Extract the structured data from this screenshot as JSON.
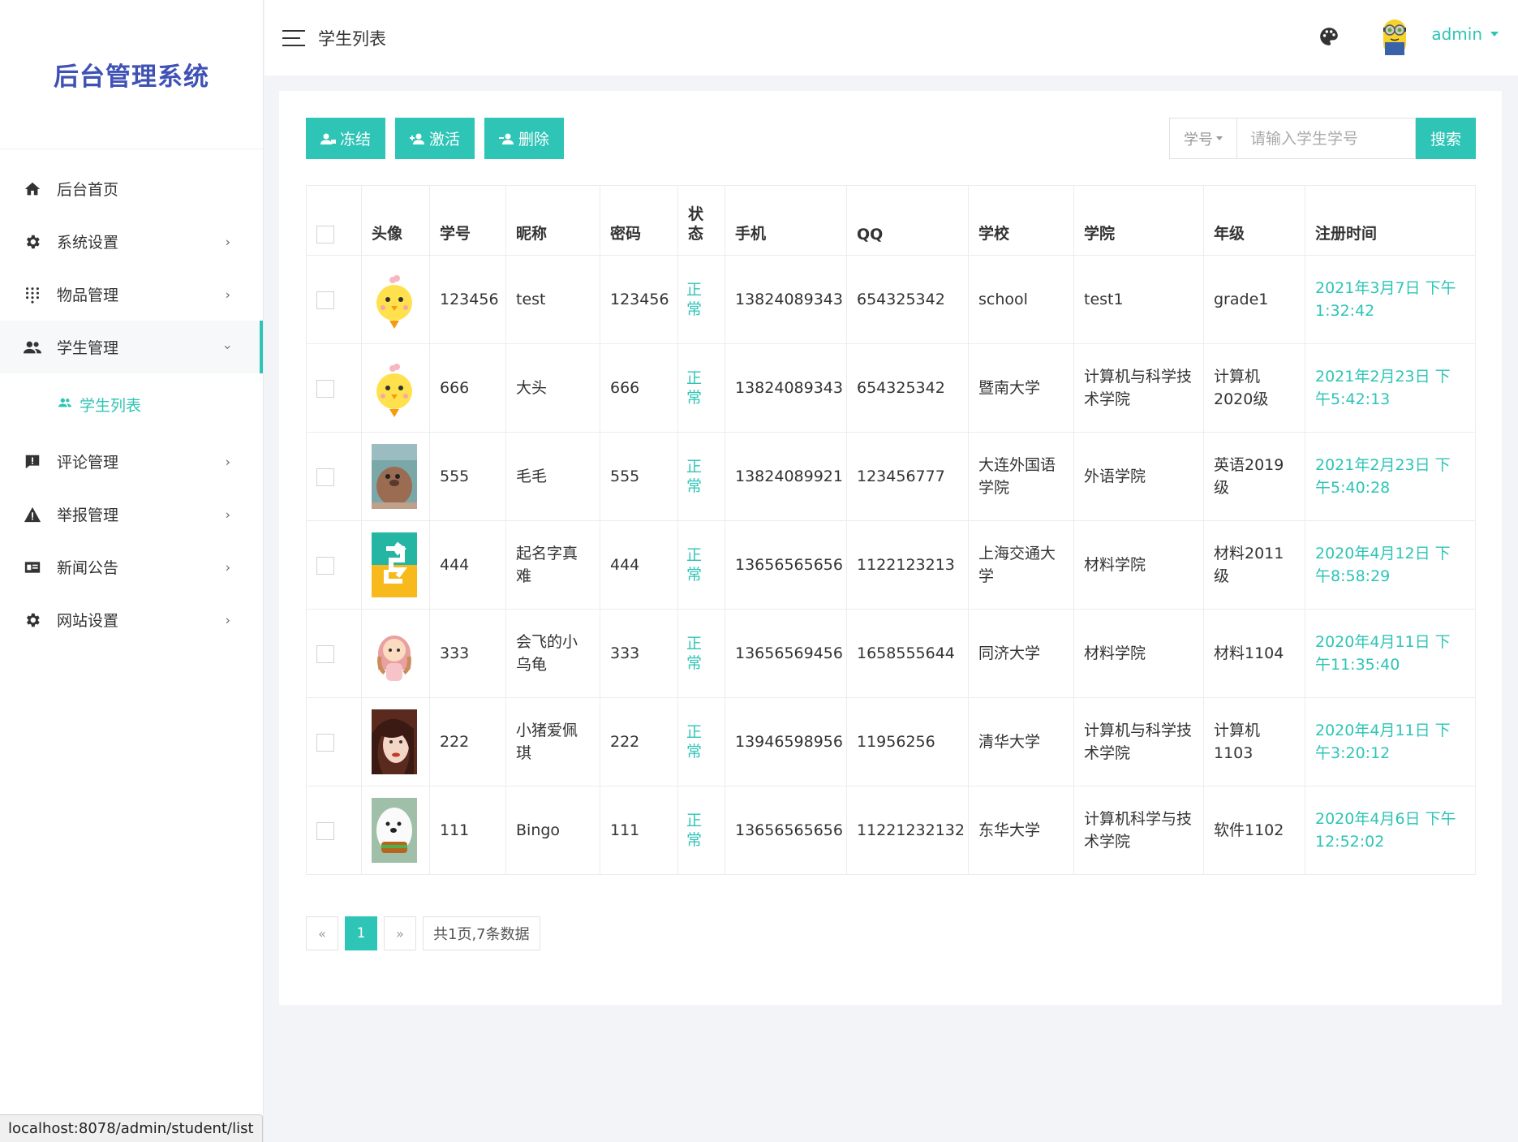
{
  "brand": "后台管理系统",
  "sidebar": {
    "items": [
      {
        "label": "后台首页",
        "icon": "home-icon"
      },
      {
        "label": "系统设置",
        "icon": "gear-icon"
      },
      {
        "label": "物品管理",
        "icon": "grid-dots-icon"
      },
      {
        "label": "学生管理",
        "icon": "users-icon"
      },
      {
        "label": "评论管理",
        "icon": "comment-icon"
      },
      {
        "label": "举报管理",
        "icon": "warning-icon"
      },
      {
        "label": "新闻公告",
        "icon": "news-icon"
      },
      {
        "label": "网站设置",
        "icon": "gear-icon"
      }
    ],
    "sub_item": "学生列表"
  },
  "header": {
    "title": "学生列表",
    "user": "admin"
  },
  "toolbar": {
    "freeze": "冻结",
    "activate": "激活",
    "delete": "删除"
  },
  "search": {
    "type": "学号",
    "placeholder": "请输入学生学号",
    "button": "搜索"
  },
  "table": {
    "headers": [
      "头像",
      "学号",
      "昵称",
      "密码",
      "状态",
      "手机",
      "QQ",
      "学校",
      "学院",
      "年级",
      "注册时间"
    ],
    "rows": [
      {
        "avatar": "chick",
        "id": "123456",
        "nick": "test",
        "pwd": "123456",
        "status": "正常",
        "phone": "13824089343",
        "qq": "654325342",
        "school": "school",
        "college": "test1",
        "grade": "grade1",
        "time": "2021年3月7日 下午1:32:42"
      },
      {
        "avatar": "chick",
        "id": "666",
        "nick": "大头",
        "pwd": "666",
        "status": "正常",
        "phone": "13824089343",
        "qq": "654325342",
        "school": "暨南大学",
        "college": "计算机与科学技术学院",
        "grade": "计算机2020级",
        "time": "2021年2月23日 下午5:42:13"
      },
      {
        "avatar": "bear",
        "id": "555",
        "nick": "毛毛",
        "pwd": "555",
        "status": "正常",
        "phone": "13824089921",
        "qq": "123456777",
        "school": "大连外国语学院",
        "college": "外语学院",
        "grade": "英语2019级",
        "time": "2021年2月23日 下午5:40:28"
      },
      {
        "avatar": "arrows",
        "id": "444",
        "nick": "起名字真难",
        "pwd": "444",
        "status": "正常",
        "phone": "13656565656",
        "qq": "1122123213",
        "school": "上海交通大学",
        "college": "材料学院",
        "grade": "材料2011级",
        "time": "2020年4月12日 下午8:58:29"
      },
      {
        "avatar": "girl",
        "id": "333",
        "nick": "会飞的小乌龟",
        "pwd": "333",
        "status": "正常",
        "phone": "13656569456",
        "qq": "1658555644",
        "school": "同济大学",
        "college": "材料学院",
        "grade": "材料1104",
        "time": "2020年4月11日 下午11:35:40"
      },
      {
        "avatar": "photo",
        "id": "222",
        "nick": "小猪爱佩琪",
        "pwd": "222",
        "status": "正常",
        "phone": "13946598956",
        "qq": "11956256",
        "school": "清华大学",
        "college": "计算机与科学技术学院",
        "grade": "计算机1103",
        "time": "2020年4月11日 下午3:20:12"
      },
      {
        "avatar": "whitebear",
        "id": "111",
        "nick": "Bingo",
        "pwd": "111",
        "status": "正常",
        "phone": "13656565656",
        "qq": "11221232132",
        "school": "东华大学",
        "college": "计算机科学与技术学院",
        "grade": "软件1102",
        "time": "2020年4月6日 下午12:52:02"
      }
    ]
  },
  "pager": {
    "prev": "«",
    "current": "1",
    "next": "»",
    "info": "共1页,7条数据"
  },
  "statusbar": "localhost:8078/admin/student/list",
  "colors": {
    "accent": "#2ec4b6",
    "brand": "#3f51b5"
  }
}
